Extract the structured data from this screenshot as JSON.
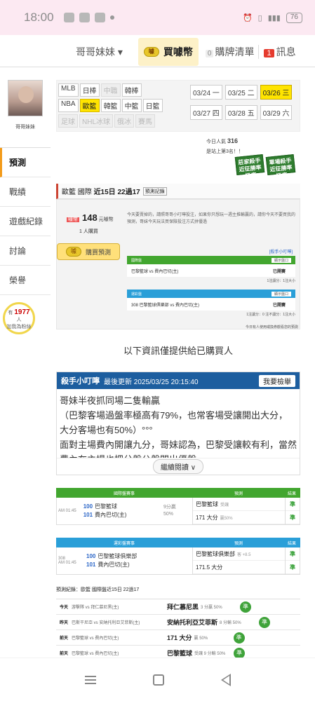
{
  "status": {
    "time": "18:00",
    "battery": "76"
  },
  "topnav": {
    "user": "哥哥妹妹 ▾",
    "buy": "買噱幣",
    "cart_count": "0",
    "cart": "購牌清單",
    "msg_count": "1",
    "msg": "訊息",
    "coin_text": "噱"
  },
  "sidebar": {
    "name": "哥哥妹妹",
    "items": [
      {
        "label": "預測"
      },
      {
        "label": "戰績"
      },
      {
        "label": "遊戲紀錄"
      },
      {
        "label": "討論"
      },
      {
        "label": "榮譽"
      }
    ],
    "fans_prefix": "有",
    "fans_count": "1977",
    "fans_suffix": "人",
    "fans_text": "加我為粉絲"
  },
  "leagues": {
    "row1": [
      {
        "label": "MLB"
      },
      {
        "label": "日棒"
      },
      {
        "label": "中職"
      },
      {
        "label": "韓棒"
      }
    ],
    "row2": [
      {
        "label": "NBA"
      },
      {
        "label": "歐籃"
      },
      {
        "label": "韓籃"
      },
      {
        "label": "中籃"
      },
      {
        "label": "日籃"
      }
    ],
    "row3": [
      {
        "label": "足球"
      },
      {
        "label": "NHL冰球"
      },
      {
        "label": "俄冰"
      },
      {
        "label": "賽馬"
      }
    ]
  },
  "dates": {
    "row1": [
      {
        "label": "03/24 一"
      },
      {
        "label": "03/25 二"
      },
      {
        "label": "03/26 三"
      }
    ],
    "row2": [
      {
        "label": "03/27 四"
      },
      {
        "label": "03/28 五"
      },
      {
        "label": "03/29 六"
      }
    ]
  },
  "stats": {
    "today_label": "今日人氣",
    "today": "316",
    "rank": "是站上第3名！！"
  },
  "stamps": [
    "莊家殺手 近征勝率極高",
    "單場殺手 近征勝率極高"
  ],
  "game": {
    "league": "歐籃 國際",
    "title": "近15日 22過17",
    "record": "預測記錄"
  },
  "pred": {
    "tag": "噱幣",
    "price": "148",
    "price_unit": "元噱幣",
    "buyers": "1 人購買",
    "buy_btn": "購買預測",
    "notice": "今天要賣掉的，請照哥哥小叮嚀投注，如果你只想玩一週主推輸贏的，請你今天不要買我的預測，哥妹今天玩法買保險投注方式拼優過",
    "link": "[殺手小叮嚀]",
    "panel1": {
      "head": "國際盤",
      "btn": "顯示盤口",
      "game": "巴黎籃球 vs 費內巴切(主)",
      "label": "已開賽",
      "foot": "1注讓分：1注大小"
    },
    "panel2": {
      "head": "運彩盤",
      "btn": "顯示盤口",
      "game": "308 巴黎籃球俱樂部 vs 費內巴切(主)",
      "label": "已開賽",
      "foot": "1注讓分：0 注不讓分：1注大小"
    },
    "today_use": "今日有人使用或換券觀看您的預測"
  },
  "info_note": "以下資訊僅提供給已購買人",
  "killer": {
    "title": "殺手小叮嚀",
    "updated": "最後更新 2025/03/25 20:15:40",
    "check": "我要檢舉",
    "text": "哥妹半夜抓同場二隻輸贏\n（巴黎客場過盤率極高有79%，也常客場受讓開出大分，大分客場也有50%）°°°\n面對主場費內開讓九分，哥妹認為，巴黎受讓較有利，當然費內在主場也把分盤公盤開出優盤",
    "more": "繼續閱讀 ∨"
  },
  "table1": {
    "headers": [
      "國際盤賽事",
      "預測",
      "結果"
    ],
    "time": "AM 01:45",
    "team1_no": "100",
    "team1": "巴黎籃球",
    "team2_no": "101",
    "team2": "費內巴切(主)",
    "hc1": "9分贏",
    "hc2": "50%",
    "pick1": "巴黎籃球",
    "pick1_sub": "受讓",
    "pick2": "171 大分",
    "pick2_sub": "贏50%",
    "res1": "準",
    "res2": "準"
  },
  "table2": {
    "headers": [
      "運彩盤賽事",
      "預測",
      "結果"
    ],
    "no": "308",
    "time": "AM 01:45",
    "team1_no": "100",
    "team1": "巴黎籃球俱樂部",
    "team2_no": "101",
    "team2": "費內巴切(主)",
    "pick1": "巴黎籃球俱樂部",
    "pick1_sub": "客 +8.5",
    "pick2": "171.5 大分",
    "res1": "準",
    "res2": "準"
  },
  "history": {
    "title": "預測紀錄：歐籃 國際盤近15日 22過17",
    "rows": [
      {
        "day": "今天",
        "game": "游擊隊 vs 拜仁慕尼黑(主)",
        "pick": "拜仁慕尼黑",
        "det": "3 分贏 50%",
        "res": "準"
      },
      {
        "day": "昨天",
        "game": "巴斯干尼亞 vs 安納托利亞艾菲斯(主)",
        "pick": "安納托利亞艾菲斯",
        "det": "8 分輸 50%",
        "res": "準"
      },
      {
        "day": "前天",
        "game": "巴黎籃球 vs 費內巴切(主)",
        "pick": "171 大分",
        "det": "贏 50%",
        "res": "準"
      },
      {
        "day": "前天",
        "game": "巴黎籃球 vs 費內巴切(主)",
        "pick": "巴黎籃球",
        "det": "受讓 9 分輸 50%",
        "res": "準"
      }
    ]
  }
}
